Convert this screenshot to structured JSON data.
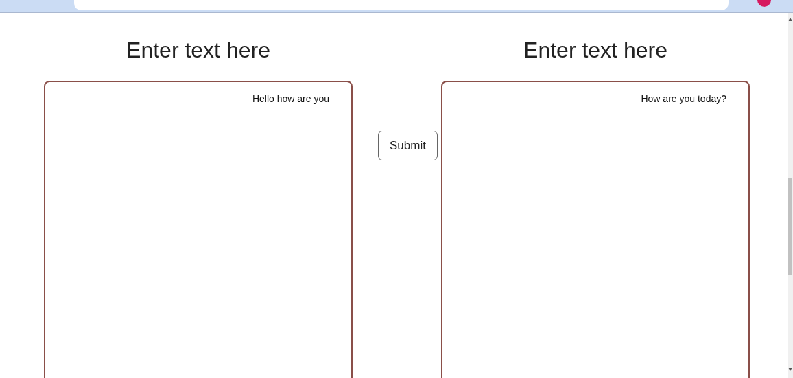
{
  "panels": [
    {
      "heading": "Enter text here",
      "value": "Hello how are you"
    },
    {
      "heading": "Enter text here",
      "value": "How are you today?"
    }
  ],
  "submit_button": {
    "label": "Submit"
  }
}
